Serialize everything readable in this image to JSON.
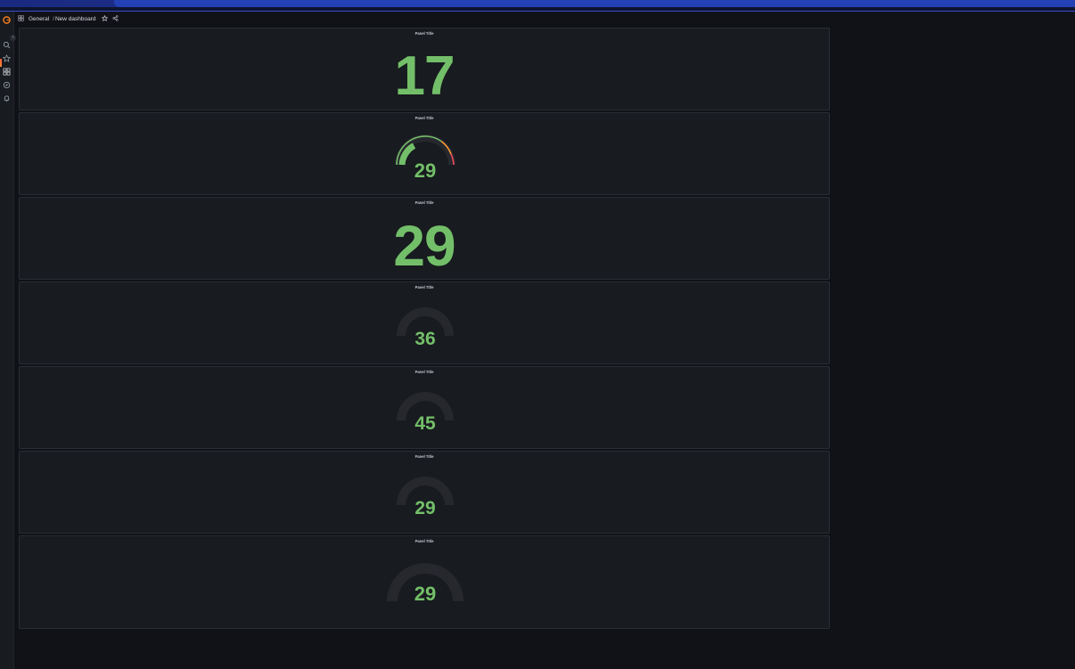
{
  "breadcrumb": {
    "folder": "General",
    "separator": "/",
    "dashboard": "New dashboard"
  },
  "sidebar": {
    "items": [
      "grafana-logo",
      "search-icon",
      "star-icon",
      "dashboards-icon",
      "explore-icon",
      "alerting-icon"
    ]
  },
  "panels": [
    {
      "title": "Panel Title",
      "type": "stat",
      "value": "17"
    },
    {
      "title": "Panel Title",
      "type": "gauge",
      "value": "29",
      "thresholds": true
    },
    {
      "title": "Panel Title",
      "type": "stat",
      "value": "29"
    },
    {
      "title": "Panel Title",
      "type": "gauge",
      "value": "36"
    },
    {
      "title": "Panel Title",
      "type": "gauge",
      "value": "45"
    },
    {
      "title": "Panel Title",
      "type": "gauge",
      "value": "29"
    },
    {
      "title": "Panel Title",
      "type": "gauge",
      "value": "29"
    }
  ],
  "colors": {
    "value_green": "#73bf69",
    "gauge_track": "#26282e",
    "threshold_orange": "#ff9830",
    "threshold_red": "#f2495c"
  }
}
